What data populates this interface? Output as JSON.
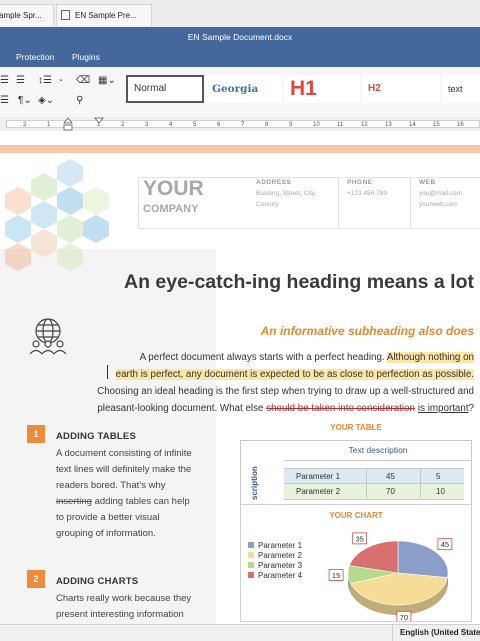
{
  "tabs": [
    {
      "label": "ample Spr..."
    },
    {
      "label": "EN Sample Pre..."
    }
  ],
  "window": {
    "title": "EN Sample Document.docx"
  },
  "menu": [
    "Protection",
    "Plugins"
  ],
  "toolbar": {
    "styles": [
      "Normal",
      "Georgia",
      "H1",
      "H2",
      "text"
    ]
  },
  "ruler": [
    "2",
    "1",
    "1",
    "2",
    "3",
    "4",
    "5",
    "6",
    "7",
    "8",
    "9",
    "10",
    "11",
    "12",
    "13",
    "14",
    "15",
    "16"
  ],
  "document": {
    "company_line1": "YOUR",
    "company_line2": "COMPANY",
    "contact": {
      "address_label": "ADDRESS",
      "address_value": "Building, Street, City, Country",
      "phone_label": "PHONE",
      "phone_value": "+123 456 789",
      "web_label": "WEB",
      "web_value1": "you@mail.com",
      "web_value2": "yourweb.com"
    },
    "heading": "An eye-catch-ing heading means a lot",
    "subheading": "An informative subheading also does",
    "para": {
      "p1": "A perfect document always starts with a perfect heading.",
      "p2": "Although nothing on",
      "p3": "earth is perfect, any document is expected to be as close to perfection as possible.",
      "p4": "Choosing an ideal heading is the first step when trying to draw up a well-structured and",
      "p5": "pleasant-looking document. What else",
      "p6": "should be taken into consideration",
      "p7": "is important",
      "p8": "?"
    },
    "sections": [
      {
        "num": "1",
        "title": "ADDING TABLES",
        "lines": [
          "A document consisting of infinite",
          "text lines will definitely make the",
          "readers bored. That’s why",
          "inserting",
          "adding tables can help",
          "to provide a better visual",
          "grouping of information."
        ]
      },
      {
        "num": "2",
        "title": "ADDING CHARTS",
        "lines": [
          "Charts really work because they",
          "present interesting information"
        ]
      }
    ],
    "table": {
      "title": "YOUR TABLE",
      "header": "Text description",
      "side_label": "scription",
      "rows": [
        [
          "Parameter 1",
          "45",
          "5"
        ],
        [
          "Parameter 2",
          "70",
          "10"
        ]
      ]
    },
    "chart_title": "YOUR CHART"
  },
  "chart_data": {
    "type": "pie",
    "title": "YOUR CHART",
    "categories": [
      "Parameter 1",
      "Parameter 2",
      "Parameter 3",
      "Parameter 4"
    ],
    "values": [
      45,
      70,
      15,
      35
    ],
    "colors": [
      "#8b9dc9",
      "#f7dc98",
      "#b7d98c",
      "#d97070"
    ],
    "legend": "left"
  },
  "status": {
    "language": "English (United States"
  },
  "colors": {
    "accent_orange": "#e8872e",
    "title_blue": "#44689c",
    "highlight": "#fbe6a6"
  }
}
